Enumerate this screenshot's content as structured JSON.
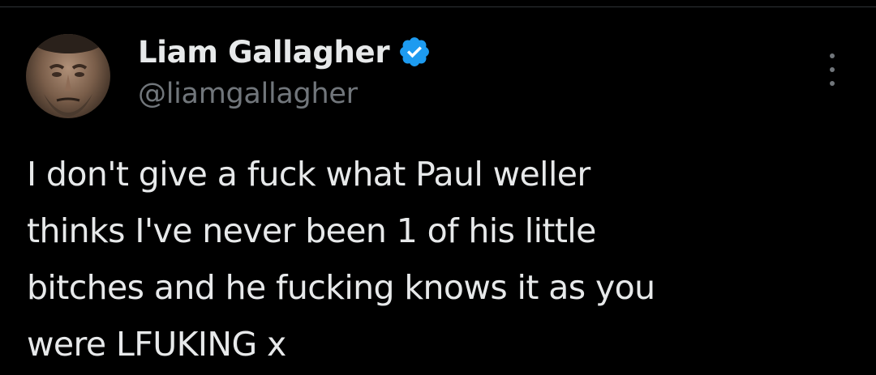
{
  "tweet": {
    "author": {
      "display_name": "Liam Gallagher",
      "handle": "@liamgallagher",
      "verified": true
    },
    "text_lines": [
      "I don't give a fuck what Paul weller",
      "thinks I've never been 1 of his little",
      "bitches and he fucking knows it as you",
      "were LFUKING x"
    ],
    "icons": {
      "verified": "verified-badge-icon",
      "more": "more-options-icon"
    }
  },
  "colors": {
    "background": "#000000",
    "primary_text": "#e7e9ea",
    "secondary_text": "#71767b",
    "verified_blue": "#1d9bf0"
  }
}
